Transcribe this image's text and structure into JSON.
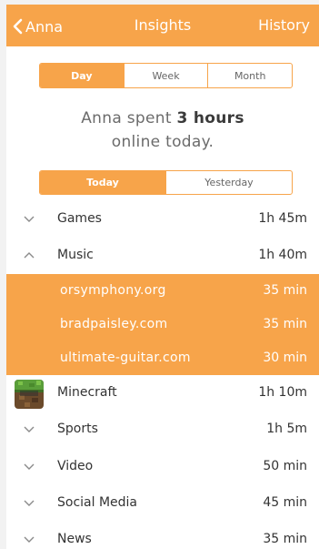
{
  "header": {
    "back_label": "Anna",
    "title": "Insights",
    "history_label": "History"
  },
  "period_tabs": [
    {
      "label": "Day",
      "active": true
    },
    {
      "label": "Week",
      "active": false
    },
    {
      "label": "Month",
      "active": false
    }
  ],
  "summary": {
    "prefix": "Anna spent",
    "duration": "3 hours",
    "line2": "online today."
  },
  "day_tabs": [
    {
      "label": "Today",
      "active": true
    },
    {
      "label": "Yesterday",
      "active": false
    }
  ],
  "categories": [
    {
      "label": "Games",
      "time": "1h 45m",
      "icon": "chevron-down-icon"
    },
    {
      "label": "Music",
      "time": "1h 40m",
      "icon": "chevron-up-icon"
    },
    {
      "label": "Minecraft",
      "time": "1h 10m",
      "icon": "minecraft-app-icon"
    },
    {
      "label": "Sports",
      "time": "1h 5m",
      "icon": "chevron-down-icon"
    },
    {
      "label": "Video",
      "time": "50 min",
      "icon": "chevron-down-icon"
    },
    {
      "label": "Social Media",
      "time": "45 min",
      "icon": "chevron-down-icon"
    },
    {
      "label": "News",
      "time": "35 min",
      "icon": "chevron-down-icon"
    }
  ],
  "music_sites": [
    {
      "label": "orsymphony.org",
      "time": "35 min"
    },
    {
      "label": "bradpaisley.com",
      "time": "35 min"
    },
    {
      "label": "ultimate-guitar.com",
      "time": "30 min"
    }
  ],
  "colors": {
    "accent": "#f7a44a",
    "text": "#333333"
  }
}
